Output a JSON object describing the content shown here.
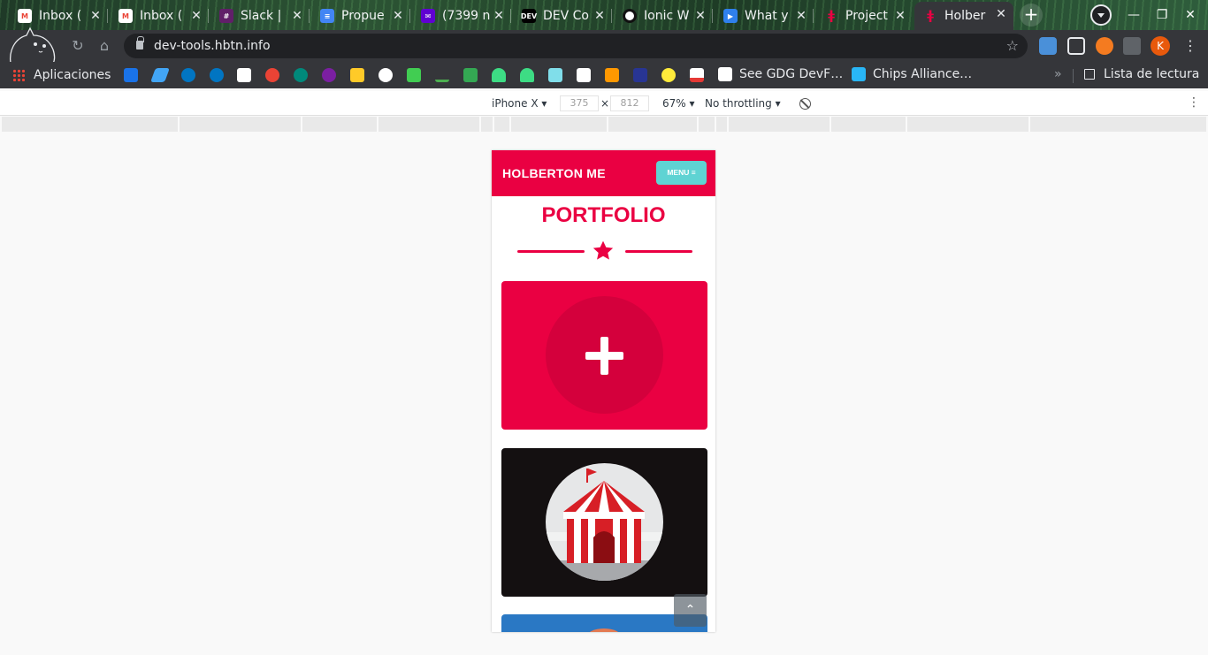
{
  "browser": {
    "tabs": [
      {
        "label": "Inbox (",
        "favicon": "gmail-icon",
        "color": "#ea4335"
      },
      {
        "label": "Inbox (",
        "favicon": "gmail-icon",
        "color": "#ea4335"
      },
      {
        "label": "Slack |",
        "favicon": "slack-icon",
        "color": "#611f69"
      },
      {
        "label": "Propue",
        "favicon": "docs-icon",
        "color": "#4285f4"
      },
      {
        "label": "(7399 n",
        "favicon": "yahoo-mail-icon",
        "color": "#6001d2"
      },
      {
        "label": "DEV Co",
        "favicon": "dev-icon",
        "color": "#000000"
      },
      {
        "label": "Ionic W",
        "favicon": "ionic-icon",
        "color": "#ffffff"
      },
      {
        "label": "What y",
        "favicon": "video-icon",
        "color": "#2f80ed"
      },
      {
        "label": "Project",
        "favicon": "holberton-icon",
        "color": "#ea0042"
      },
      {
        "label": "Holber",
        "favicon": "holberton-icon",
        "color": "#ea0042",
        "active": true
      }
    ],
    "new_tab": "+",
    "url": "dev-tools.hbtn.info",
    "profile_initial": "K",
    "bookmarks": {
      "apps_label": "Aplicaciones",
      "gdg_label": "See GDG DevF…",
      "chips_label": "Chips Alliance…",
      "more": "»",
      "reading_list": "Lista de lectura"
    }
  },
  "devtools": {
    "device": "iPhone X",
    "width": "375",
    "height": "812",
    "times": "×",
    "zoom": "67%",
    "throttling": "No throttling"
  },
  "site": {
    "brand": "HOLBERTON ME",
    "menu_label": "MENU ≡",
    "section_title": "PORTFOLIO",
    "accent_color": "#ea0042",
    "menu_color": "#5fd3d3",
    "scroll_top": "⌃"
  }
}
